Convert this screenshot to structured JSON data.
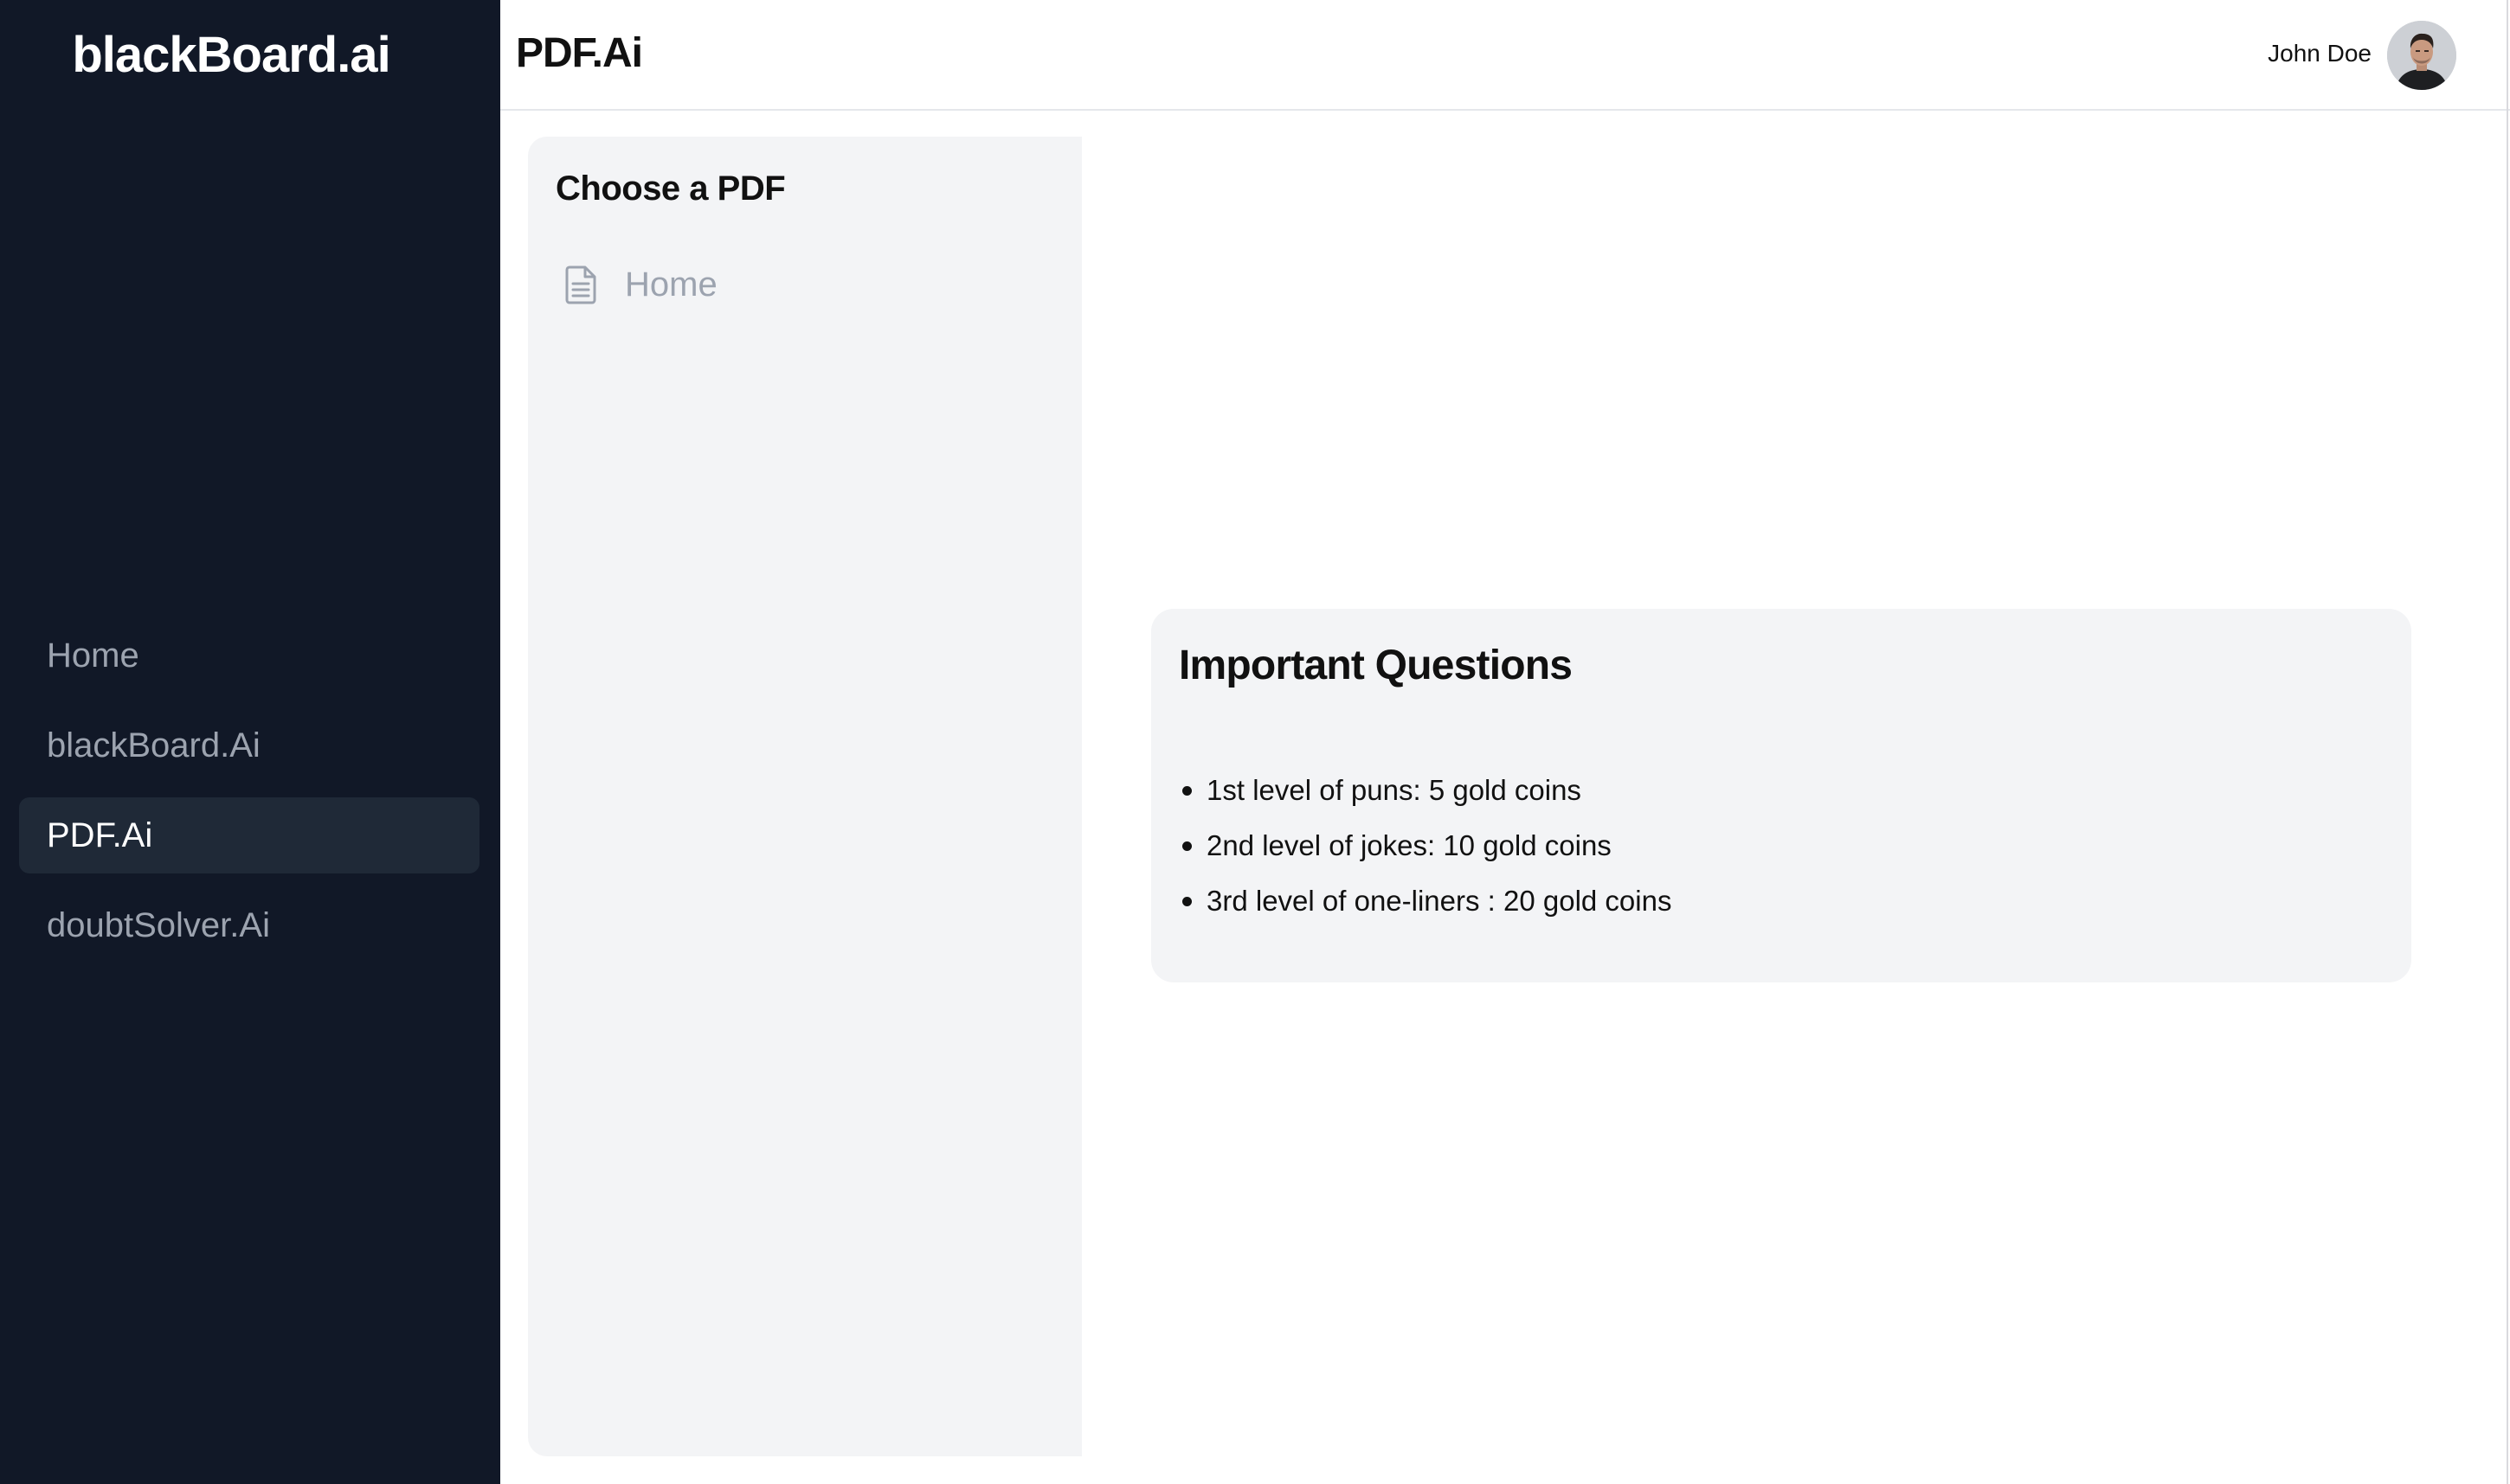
{
  "sidebar": {
    "brand": "blackBoard.ai",
    "items": [
      {
        "label": "Home",
        "active": false
      },
      {
        "label": "blackBoard.Ai",
        "active": false
      },
      {
        "label": "PDF.Ai",
        "active": true
      },
      {
        "label": "doubtSolver.Ai",
        "active": false
      }
    ]
  },
  "header": {
    "title": "PDF.Ai",
    "user_name": "John Doe",
    "avatar_icon": "user-avatar"
  },
  "pdf_panel": {
    "title": "Choose a PDF",
    "items": [
      {
        "label": "Home",
        "icon": "document-icon"
      }
    ]
  },
  "questions_card": {
    "title": "Important Questions",
    "items": [
      "1st level of puns: 5 gold coins",
      "2nd level of jokes: 10 gold coins",
      "3rd level of one-liners : 20 gold coins"
    ]
  },
  "colors": {
    "sidebar_bg": "#111827",
    "sidebar_active_bg": "#1f2937",
    "sidebar_text": "#9ca3af",
    "panel_bg": "#f3f4f6",
    "text": "#111111"
  }
}
